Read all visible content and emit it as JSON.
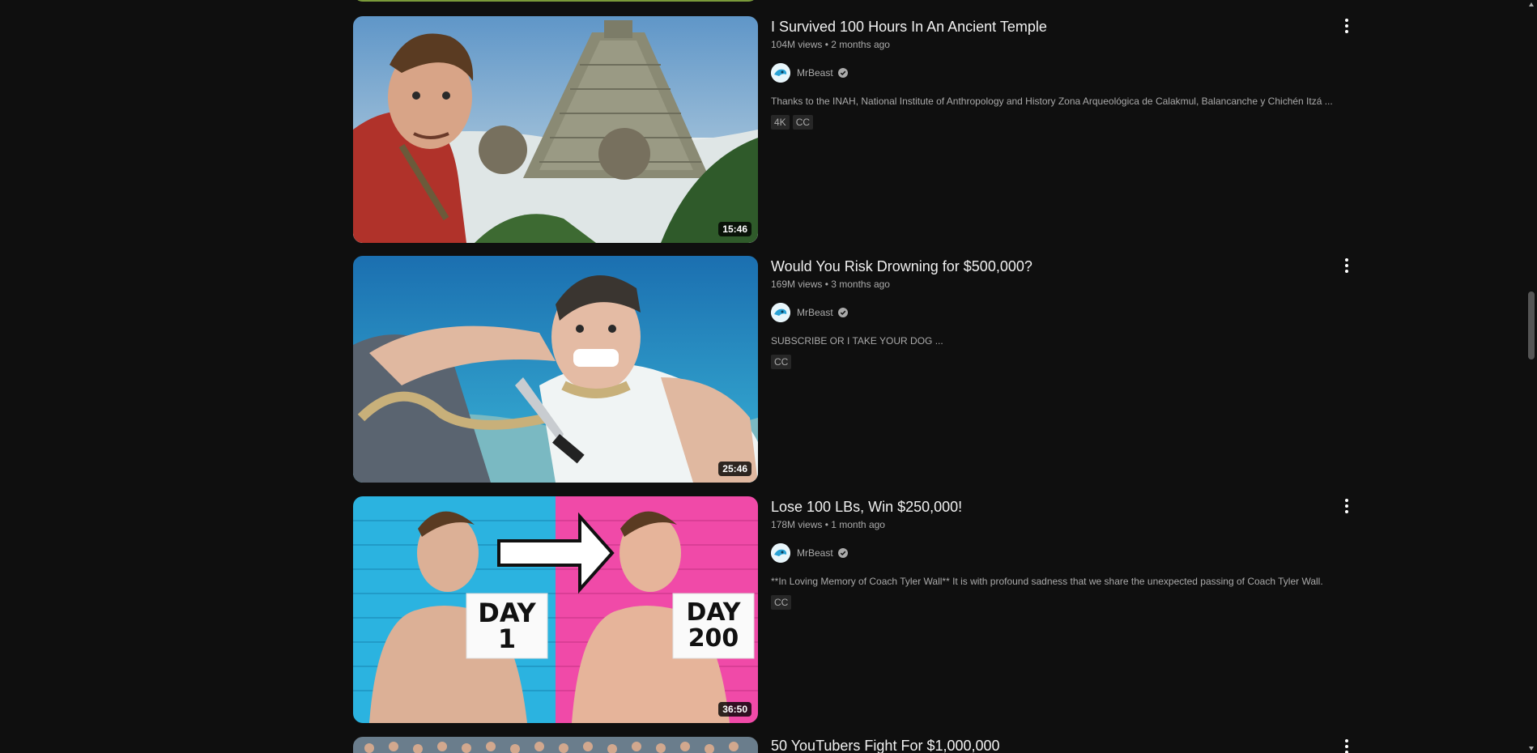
{
  "videos": [
    {
      "title": "I Survived 100 Hours In An Ancient Temple",
      "views": "104M views",
      "age": "2 months ago",
      "channel": "MrBeast",
      "description": "Thanks to the INAH, National Institute of Anthropology and History Zona Arqueológica de Calakmul, Balancanche y Chichén Itzá ...",
      "badges": [
        "4K",
        "CC"
      ],
      "duration": "15:46"
    },
    {
      "title": "Would You Risk Drowning for $500,000?",
      "views": "169M views",
      "age": "3 months ago",
      "channel": "MrBeast",
      "description": "SUBSCRIBE OR I TAKE YOUR DOG ...",
      "badges": [
        "CC"
      ],
      "duration": "25:46"
    },
    {
      "title": "Lose 100 LBs, Win $250,000!",
      "views": "178M views",
      "age": "1 month ago",
      "channel": "MrBeast",
      "description": "**In Loving Memory of Coach Tyler Wall** It is with profound sadness that we share the unexpected passing of Coach Tyler Wall.",
      "badges": [
        "CC"
      ],
      "duration": "36:50",
      "thumb_text": {
        "left": "DAY 1",
        "right": "DAY 200"
      }
    },
    {
      "title": "50 YouTubers Fight For $1,000,000"
    }
  ],
  "icons": {
    "menu": "more-vert-icon",
    "verified": "verified-check-icon"
  }
}
